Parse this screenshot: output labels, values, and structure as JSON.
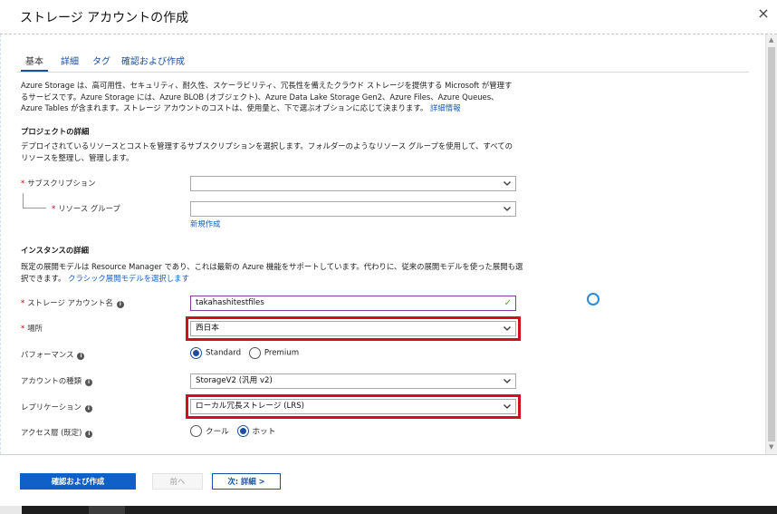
{
  "window": {
    "title": "ストレージ アカウントの作成",
    "close_icon": "×"
  },
  "tabs": [
    {
      "label": "基本"
    },
    {
      "label": "詳細"
    },
    {
      "label": "タグ"
    },
    {
      "label": "確認および作成"
    }
  ],
  "intro": {
    "text": "Azure Storage は、高可用性、セキュリティ、耐久性、スケーラビリティ、冗長性を備えたクラウド ストレージを提供する Microsoft が管理するサービスです。Azure Storage には、Azure BLOB (オブジェクト)、Azure Data Lake Storage Gen2、Azure Files、Azure Queues、Azure Tables が含まれます。ストレージ アカウントのコストは、使用量と、下で選ぶオプションに応じて決まります。",
    "link": "詳細情報"
  },
  "project": {
    "heading": "プロジェクトの詳細",
    "description": "デプロイされているリソースとコストを管理するサブスクリプションを選択します。フォルダーのようなリソース グループを使用して、すべてのリソースを整理し、管理します。",
    "subscription_label": "サブスクリプション",
    "subscription_value": "",
    "resource_group_label": "リソース グループ",
    "resource_group_value": "",
    "create_new": "新規作成"
  },
  "instance": {
    "heading": "インスタンスの詳細",
    "description": "既定の展開モデルは Resource Manager であり、これは最新の Azure 機能をサポートしています。代わりに、従来の展開モデルを使った展開も選択できます。",
    "classic_link": "クラシック展開モデルを選択します",
    "account_name_label": "ストレージ アカウント名",
    "account_name_value": "takahashitestfiles",
    "location_label": "場所",
    "location_value": "西日本",
    "performance_label": "パフォーマンス",
    "performance_options": [
      "Standard",
      "Premium"
    ],
    "performance_selected": "Standard",
    "account_kind_label": "アカウントの種類",
    "account_kind_value": "StorageV2 (汎用 v2)",
    "replication_label": "レプリケーション",
    "replication_value": "ローカル冗長ストレージ (LRS)",
    "access_tier_label": "アクセス層 (既定)",
    "access_tier_options": [
      "クール",
      "ホット"
    ],
    "access_tier_selected": "ホット"
  },
  "footer": {
    "review_create": "確認および作成",
    "previous": "前へ",
    "next": "次: 詳細 >"
  },
  "colors": {
    "primary": "#1160c8",
    "link": "#1b5fb4",
    "highlight": "#d01020",
    "required": "#c00000"
  }
}
